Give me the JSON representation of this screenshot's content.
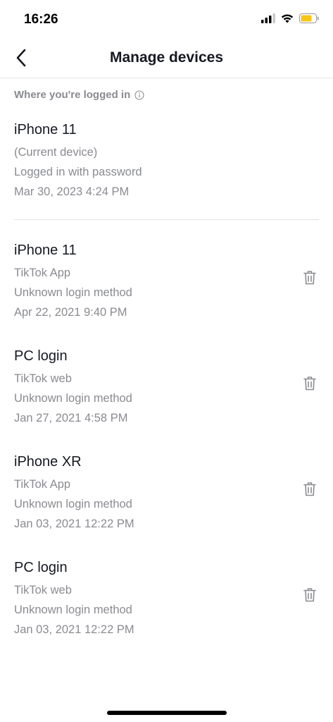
{
  "status_bar": {
    "time": "16:26",
    "icons": [
      "signal-icon",
      "wifi-icon",
      "battery-icon"
    ],
    "battery_color": "#F5C518"
  },
  "nav": {
    "title": "Manage devices",
    "back_icon": "chevron-left-icon"
  },
  "section": {
    "header": "Where you're logged in"
  },
  "current_device": {
    "name": "iPhone 11",
    "lines": [
      "(Current device)",
      "Logged in with password",
      "Mar 30, 2023 4:24 PM"
    ]
  },
  "devices": [
    {
      "name": "iPhone 11",
      "lines": [
        "TikTok App",
        "Unknown login method",
        "Apr 22, 2021 9:40 PM"
      ]
    },
    {
      "name": "PC login",
      "lines": [
        "TikTok web",
        "Unknown login method",
        "Jan 27, 2021 4:58 PM"
      ]
    },
    {
      "name": "iPhone XR",
      "lines": [
        "TikTok App",
        "Unknown login method",
        "Jan 03, 2021 12:22 PM"
      ]
    },
    {
      "name": "PC login",
      "lines": [
        "TikTok web",
        "Unknown login method",
        "Jan 03, 2021 12:22 PM"
      ]
    }
  ]
}
